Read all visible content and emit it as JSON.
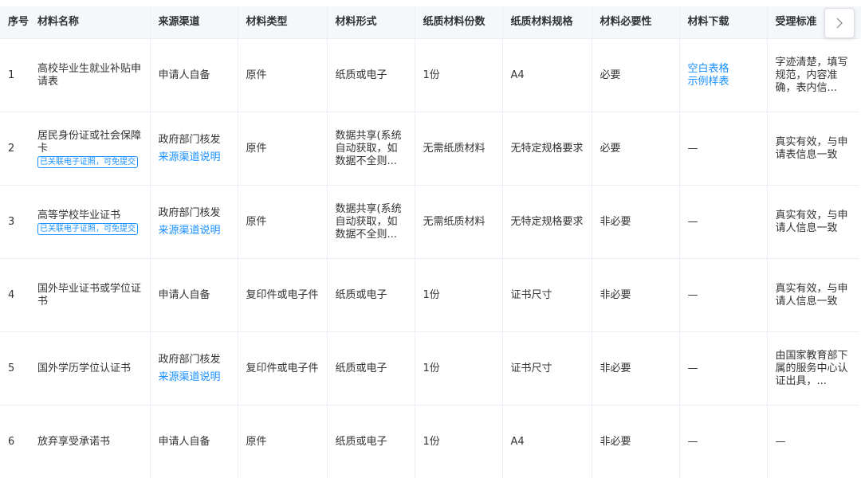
{
  "headers": [
    "序号",
    "材料名称",
    "来源渠道",
    "材料类型",
    "材料形式",
    "纸质材料份数",
    "纸质材料规格",
    "材料必要性",
    "材料下载",
    "受理标准"
  ],
  "rows": [
    {
      "seq": "1",
      "name": "高校毕业生就业补贴申请表",
      "tag": "",
      "source": "申请人自备",
      "source_link": "",
      "type": "原件",
      "form": "纸质或电子",
      "copies": "1份",
      "spec": "A4",
      "required": "必要",
      "download_1": "空白表格",
      "download_2": "示例样表",
      "standard": "字迹清楚，填写规范，内容准确，表内信..."
    },
    {
      "seq": "2",
      "name": "居民身份证或社会保障卡",
      "tag": "已关联电子证照，可免提交",
      "source": "政府部门核发",
      "source_link": "来源渠道说明",
      "type": "原件",
      "form": "数据共享(系统自动获取，如数据不全则...",
      "copies": "无需纸质材料",
      "spec": "无特定规格要求",
      "required": "必要",
      "download_1": "—",
      "download_2": "",
      "standard": "真实有效，与申请表信息一致"
    },
    {
      "seq": "3",
      "name": "高等学校毕业证书",
      "tag": "已关联电子证照，可免提交",
      "source": "政府部门核发",
      "source_link": "来源渠道说明",
      "type": "原件",
      "form": "数据共享(系统自动获取，如数据不全则...",
      "copies": "无需纸质材料",
      "spec": "无特定规格要求",
      "required": "非必要",
      "download_1": "—",
      "download_2": "",
      "standard": "真实有效，与申请人信息一致"
    },
    {
      "seq": "4",
      "name": "国外毕业证书或学位证书",
      "tag": "",
      "source": "申请人自备",
      "source_link": "",
      "type": "复印件或电子件",
      "form": "纸质或电子",
      "copies": "1份",
      "spec": "证书尺寸",
      "required": "非必要",
      "download_1": "—",
      "download_2": "",
      "standard": "真实有效，与申请人信息一致"
    },
    {
      "seq": "5",
      "name": "国外学历学位认证书",
      "tag": "",
      "source": "政府部门核发",
      "source_link": "来源渠道说明",
      "type": "复印件或电子件",
      "form": "纸质或电子",
      "copies": "1份",
      "spec": "证书尺寸",
      "required": "非必要",
      "download_1": "—",
      "download_2": "",
      "standard": "由国家教育部下属的服务中心认证出具，..."
    },
    {
      "seq": "6",
      "name": "放弃享受承诺书",
      "tag": "",
      "source": "申请人自备",
      "source_link": "",
      "type": "原件",
      "form": "纸质或电子",
      "copies": "1份",
      "spec": "A4",
      "required": "非必要",
      "download_1": "—",
      "download_2": "",
      "standard": "—"
    }
  ],
  "icons": {
    "scroll_right": "chevron-right-icon"
  },
  "colors": {
    "link": "#1890ff",
    "header_bg": "#f5f7fa",
    "border": "#ebeef5"
  }
}
